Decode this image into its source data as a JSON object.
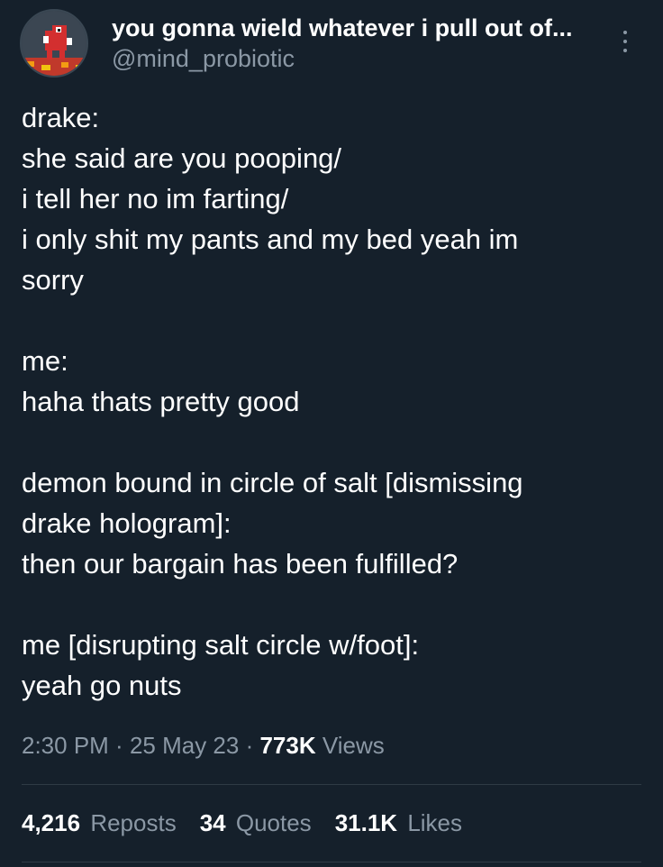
{
  "author": {
    "display_name": "you gonna wield whatever i pull out of...",
    "handle": "@mind_probiotic",
    "avatar_icon": "red-yoshi-pixel-avatar"
  },
  "more_icon": "more-options-icon",
  "tweet": {
    "paragraphs": [
      [
        "drake:",
        "she said are you pooping/",
        "i tell her no im farting/",
        "i only shit my pants and my bed yeah im",
        "sorry"
      ],
      [
        "me:",
        "haha thats pretty good"
      ],
      [
        "demon bound in circle of salt [dismissing",
        "drake hologram]:",
        "then our bargain has been fulfilled?"
      ],
      [
        "me [disrupting salt circle w/foot]:",
        "yeah go nuts"
      ]
    ]
  },
  "meta": {
    "time": "2:30 PM",
    "sep1": " · ",
    "date": "25 May 23",
    "sep2": " · ",
    "views_count": "773K",
    "views_label": " Views"
  },
  "stats": {
    "reposts_count": "4,216",
    "reposts_label": "Reposts",
    "quotes_count": "34",
    "quotes_label": "Quotes",
    "likes_count": "31.1K",
    "likes_label": "Likes"
  },
  "colors": {
    "background": "#15202b",
    "secondary_text": "#8b98a5",
    "divider": "#2f3b45"
  }
}
